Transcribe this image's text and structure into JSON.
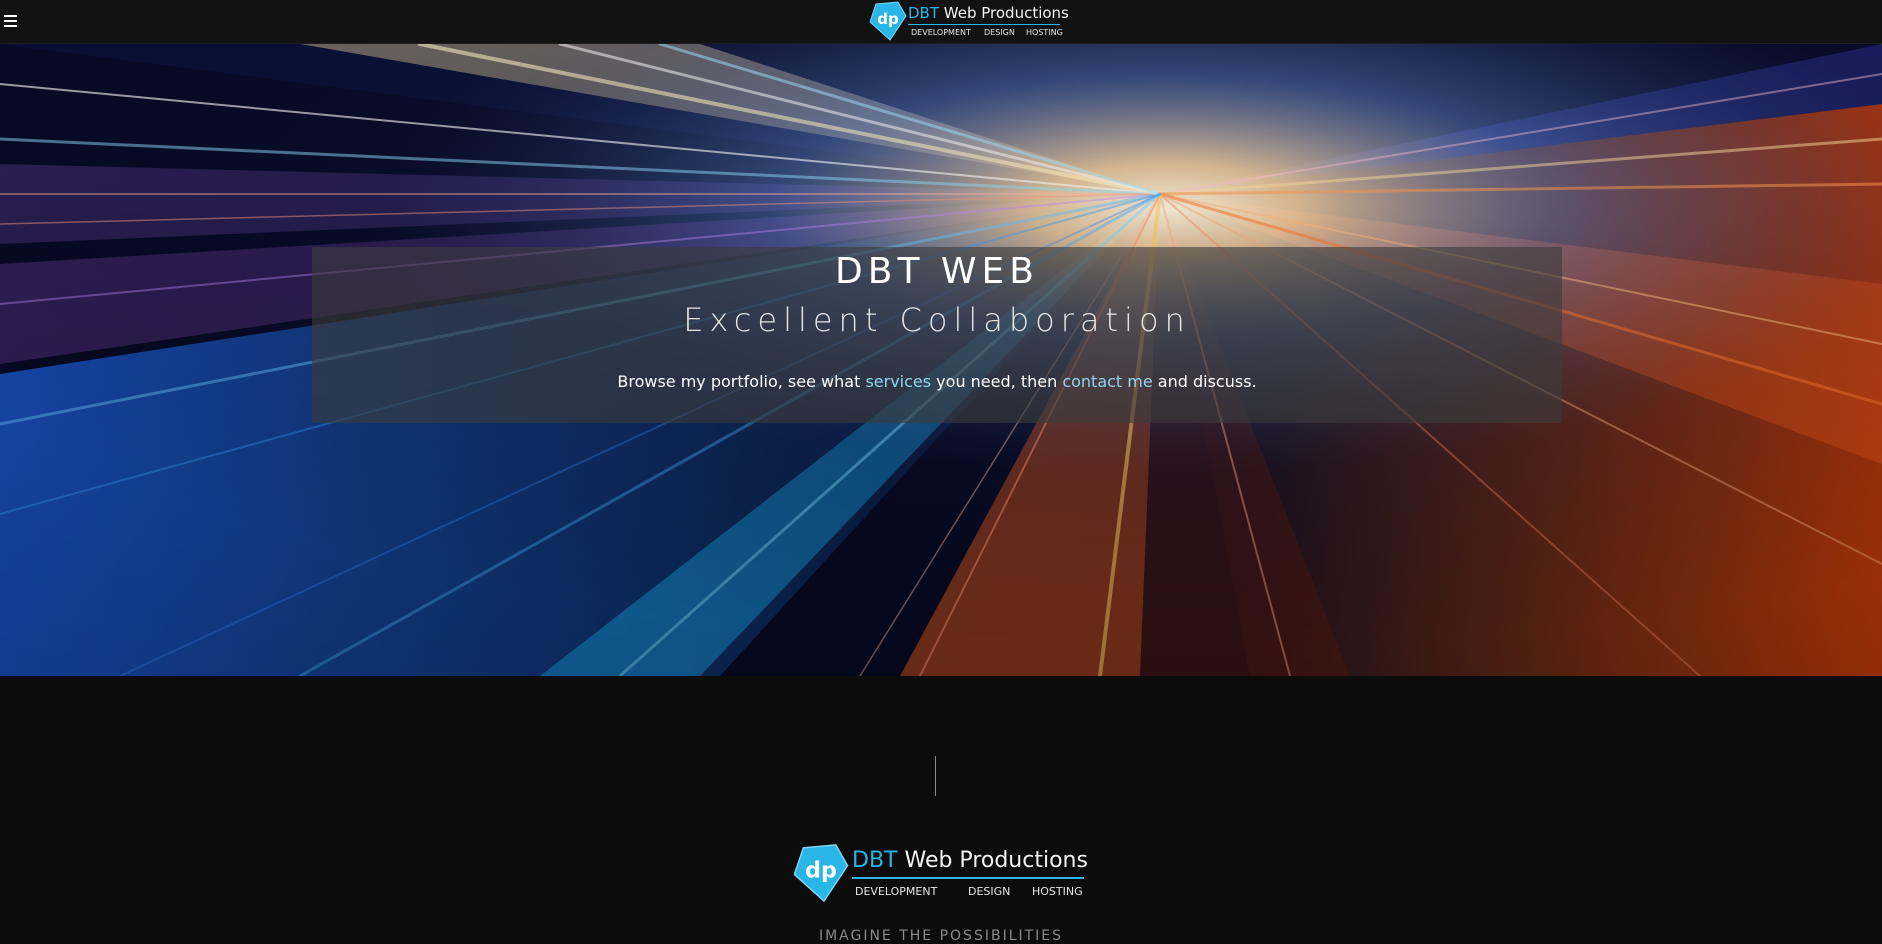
{
  "nav": {
    "menu_icon": "hamburger-menu-icon"
  },
  "logo": {
    "badge_letters": "dp",
    "brand_accent": "DBT",
    "brand_rest": " Web Productions",
    "services": [
      "DEVELOPMENT",
      "DESIGN",
      "HOSTING"
    ]
  },
  "hero": {
    "title": "DBT WEB",
    "subtitle": "Excellent Collaboration",
    "lead_part1": "Browse my portfolio, see what ",
    "services_link": "services",
    "lead_part2": " you need, then ",
    "contact_link": "contact me",
    "lead_part3": " and discuss."
  },
  "footer": {
    "tagline": "IMAGINE THE POSSIBILITIES"
  },
  "colors": {
    "accent": "#29b6e6",
    "link": "#8fd4f0",
    "background": "#0c0c0c"
  }
}
